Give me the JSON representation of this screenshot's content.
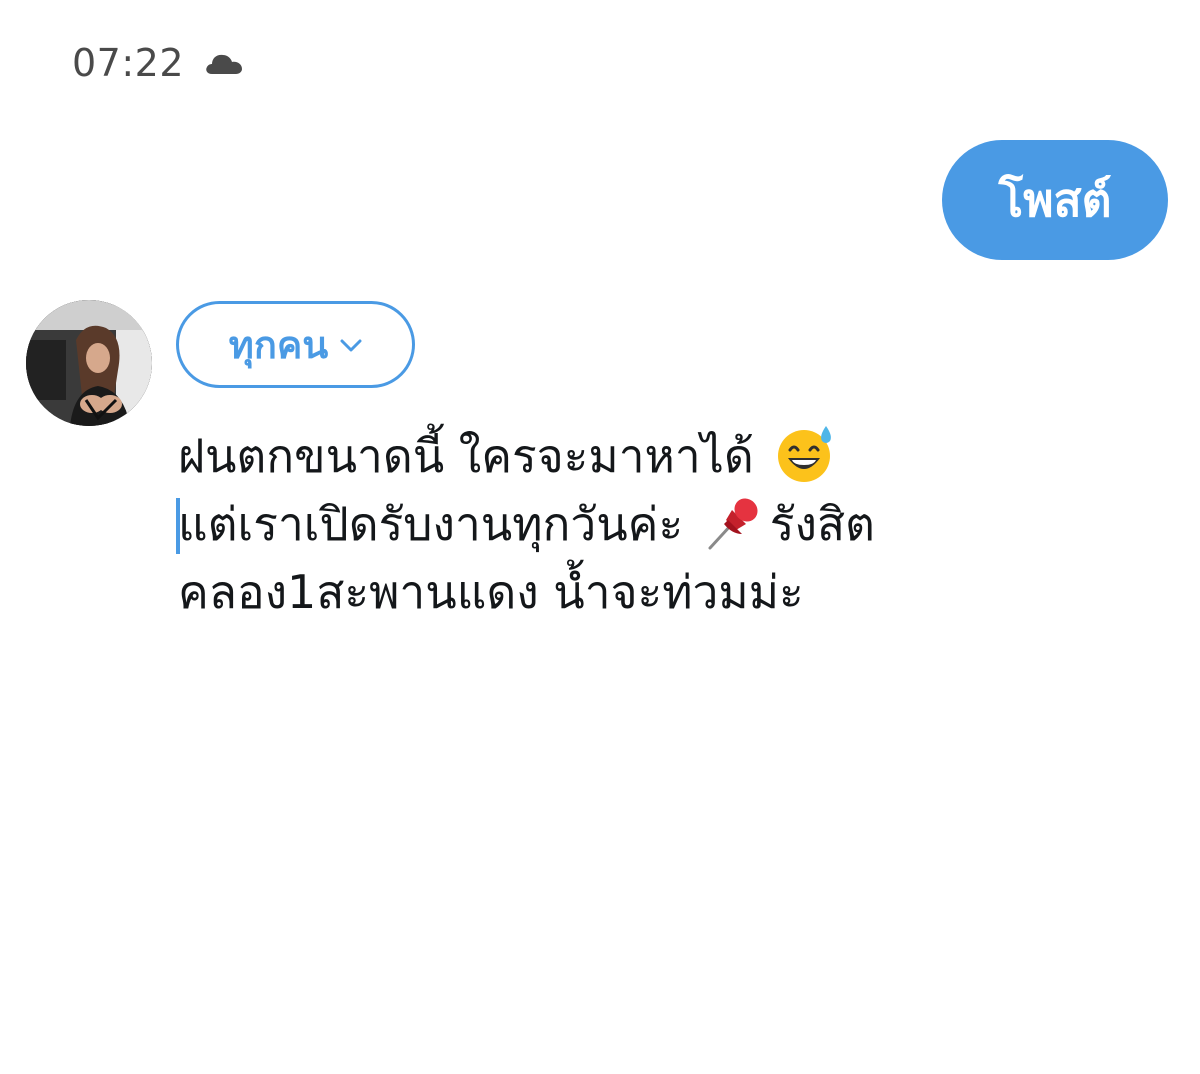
{
  "status_bar": {
    "time": "07:22",
    "weather_icon": "cloud-icon"
  },
  "header": {
    "post_label": "โพสต์"
  },
  "composer": {
    "avatar_icon": "avatar-photo",
    "audience_label": "ทุกคน",
    "audience_icon": "chevron-down-icon",
    "lines": {
      "line1_text": "ฝนตกขนาดนี้ ใครจะมาหาได้",
      "line1_emoji": "grinning-face-with-sweat-emoji",
      "line2_text_a": "แต่เราเปิดรับงานทุกวันค่ะ ",
      "line2_emoji": "pushpin-emoji",
      "line2_text_b": "รังสิต",
      "line3_text": "คลอง1สะพานแดง น้ำจะท่วมม่ะ"
    }
  },
  "colors": {
    "accent": "#4a9ae4",
    "text": "#14171a",
    "status_text": "#4a4a4a",
    "background": "#ffffff"
  }
}
